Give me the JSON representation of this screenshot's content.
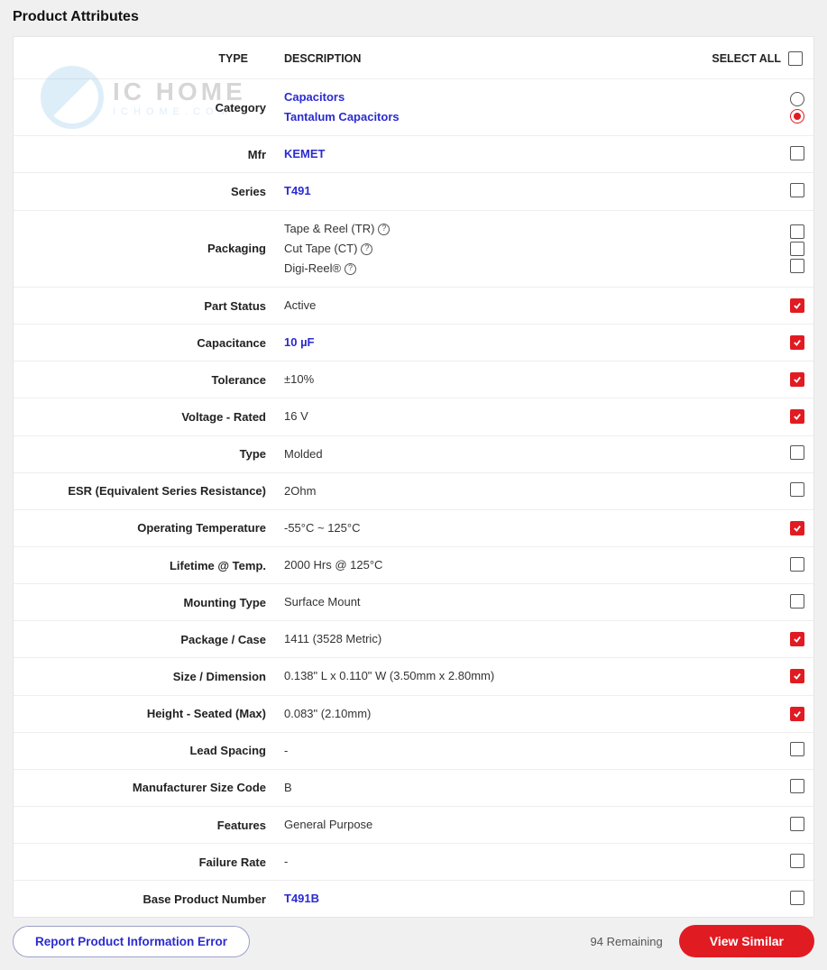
{
  "title": "Product Attributes",
  "watermark": {
    "line1": "IC HOME",
    "line2": "ICHOME.COM"
  },
  "headers": {
    "type": "TYPE",
    "description": "DESCRIPTION",
    "select_all": "SELECT ALL"
  },
  "rows": [
    {
      "type": "Category",
      "desc": [
        {
          "text": "Capacitors",
          "link": true
        },
        {
          "text": "Tantalum Capacitors",
          "link": true
        }
      ],
      "control": "radio-pair",
      "radio": [
        false,
        true
      ]
    },
    {
      "type": "Mfr",
      "desc": [
        {
          "text": "KEMET",
          "link": true
        }
      ],
      "control": "checkbox",
      "checked": false
    },
    {
      "type": "Series",
      "desc": [
        {
          "text": "T491",
          "link": true
        }
      ],
      "control": "checkbox",
      "checked": false
    },
    {
      "type": "Packaging",
      "desc": [
        {
          "text": "Tape & Reel (TR)",
          "help": true
        },
        {
          "text": "Cut Tape (CT)",
          "help": true
        },
        {
          "text": "Digi-Reel®",
          "help": true
        }
      ],
      "control": "checkbox-triple",
      "checked": [
        false,
        false,
        false
      ]
    },
    {
      "type": "Part Status",
      "desc": [
        {
          "text": "Active"
        }
      ],
      "control": "checkbox",
      "checked": true
    },
    {
      "type": "Capacitance",
      "desc": [
        {
          "text": "10 µF",
          "link": true
        }
      ],
      "control": "checkbox",
      "checked": true
    },
    {
      "type": "Tolerance",
      "desc": [
        {
          "text": "±10%"
        }
      ],
      "control": "checkbox",
      "checked": true
    },
    {
      "type": "Voltage - Rated",
      "desc": [
        {
          "text": "16 V"
        }
      ],
      "control": "checkbox",
      "checked": true
    },
    {
      "type": "Type",
      "desc": [
        {
          "text": "Molded"
        }
      ],
      "control": "checkbox",
      "checked": false
    },
    {
      "type": "ESR (Equivalent Series Resistance)",
      "desc": [
        {
          "text": "2Ohm"
        }
      ],
      "control": "checkbox",
      "checked": false
    },
    {
      "type": "Operating Temperature",
      "desc": [
        {
          "text": "-55°C ~ 125°C"
        }
      ],
      "control": "checkbox",
      "checked": true
    },
    {
      "type": "Lifetime @ Temp.",
      "desc": [
        {
          "text": "2000 Hrs @ 125°C"
        }
      ],
      "control": "checkbox",
      "checked": false
    },
    {
      "type": "Mounting Type",
      "desc": [
        {
          "text": "Surface Mount"
        }
      ],
      "control": "checkbox",
      "checked": false
    },
    {
      "type": "Package / Case",
      "desc": [
        {
          "text": "1411 (3528 Metric)"
        }
      ],
      "control": "checkbox",
      "checked": true
    },
    {
      "type": "Size / Dimension",
      "desc": [
        {
          "text": "0.138\" L x 0.110\" W (3.50mm x 2.80mm)"
        }
      ],
      "control": "checkbox",
      "checked": true
    },
    {
      "type": "Height - Seated (Max)",
      "desc": [
        {
          "text": "0.083\" (2.10mm)"
        }
      ],
      "control": "checkbox",
      "checked": true
    },
    {
      "type": "Lead Spacing",
      "desc": [
        {
          "text": "-"
        }
      ],
      "control": "checkbox",
      "checked": false
    },
    {
      "type": "Manufacturer Size Code",
      "desc": [
        {
          "text": "B"
        }
      ],
      "control": "checkbox",
      "checked": false
    },
    {
      "type": "Features",
      "desc": [
        {
          "text": "General Purpose"
        }
      ],
      "control": "checkbox",
      "checked": false
    },
    {
      "type": "Failure Rate",
      "desc": [
        {
          "text": "-"
        }
      ],
      "control": "checkbox",
      "checked": false
    },
    {
      "type": "Base Product Number",
      "desc": [
        {
          "text": "T491B",
          "link": true
        }
      ],
      "control": "checkbox",
      "checked": false
    }
  ],
  "footer": {
    "report_error": "Report Product Information Error",
    "remaining": "94 Remaining",
    "view_similar": "View Similar"
  }
}
